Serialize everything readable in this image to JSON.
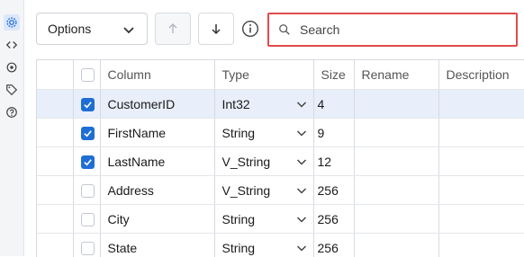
{
  "rail": {
    "icons": [
      "gear-icon",
      "code-icon",
      "settings-cog-icon",
      "tag-icon",
      "help-icon"
    ]
  },
  "toolbar": {
    "options_label": "Options",
    "search_placeholder": "Search"
  },
  "grid": {
    "headers": {
      "column": "Column",
      "type": "Type",
      "size": "Size",
      "rename": "Rename",
      "description": "Description"
    },
    "rows": [
      {
        "checked": true,
        "column": "CustomerID",
        "type": "Int32",
        "size": "4"
      },
      {
        "checked": true,
        "column": "FirstName",
        "type": "String",
        "size": "9"
      },
      {
        "checked": true,
        "column": "LastName",
        "type": "V_String",
        "size": "12"
      },
      {
        "checked": false,
        "column": "Address",
        "type": "V_String",
        "size": "256"
      },
      {
        "checked": false,
        "column": "City",
        "type": "String",
        "size": "256"
      },
      {
        "checked": false,
        "column": "State",
        "type": "String",
        "size": "256"
      }
    ]
  },
  "colors": {
    "accent": "#1f6ed4",
    "highlight_border": "#e24b4b",
    "selected_row": "#e8effa"
  }
}
